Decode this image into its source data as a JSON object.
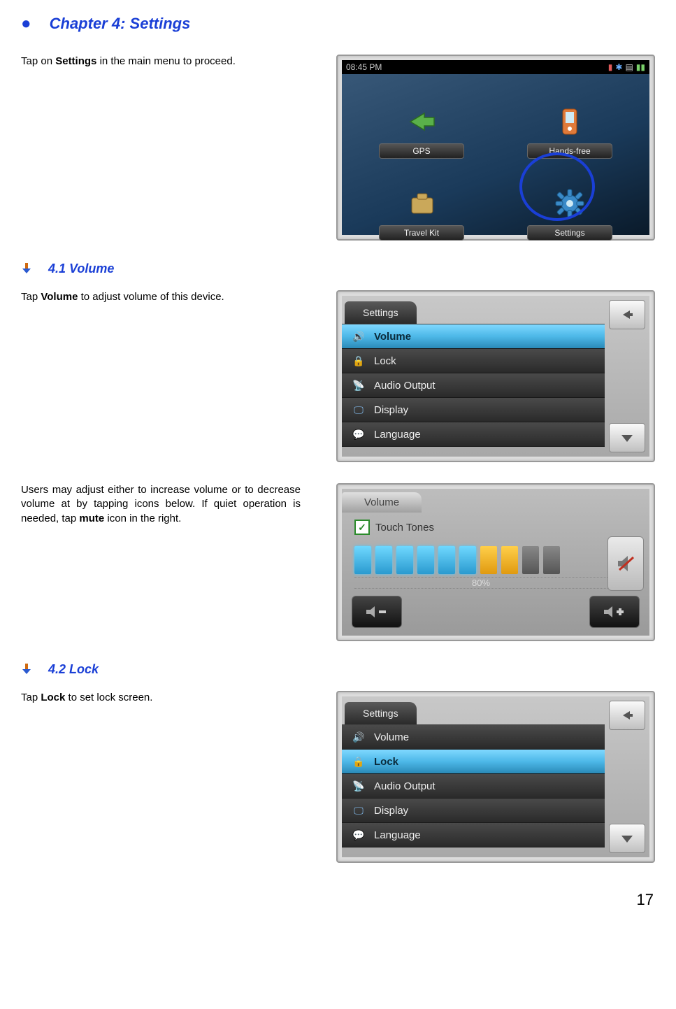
{
  "chapter": {
    "title": "Chapter 4: Settings"
  },
  "intro": {
    "before": "Tap on ",
    "bold": "Settings",
    "after": " in the main menu to proceed."
  },
  "main_menu_shot": {
    "time": "08:45 PM",
    "buttons": [
      "GPS",
      "Hands-free",
      "Travel Kit",
      "Settings"
    ]
  },
  "sec41": {
    "title": "4.1 Volume",
    "text_before": "Tap ",
    "text_bold": "Volume",
    "text_after": " to adjust volume of this device."
  },
  "settings_list1": {
    "tab": "Settings",
    "items": [
      "Volume",
      "Lock",
      "Audio Output",
      "Display",
      "Language"
    ]
  },
  "volume_para": {
    "t1": "Users may adjust either to increase volume or to decrease volume at by tapping icons below.   If quiet operation is needed, tap ",
    "bold": "mute",
    "t2": " icon in the right."
  },
  "volume_shot": {
    "tab": "Volume",
    "touch_tones": "Touch Tones",
    "percent": "80%"
  },
  "sec42": {
    "title": "4.2 Lock",
    "text_before": "Tap ",
    "text_bold": "Lock",
    "text_after": " to set lock screen."
  },
  "settings_list2": {
    "tab": "Settings",
    "items": [
      "Volume",
      "Lock",
      "Audio Output",
      "Display",
      "Language"
    ]
  },
  "page_number": "17"
}
